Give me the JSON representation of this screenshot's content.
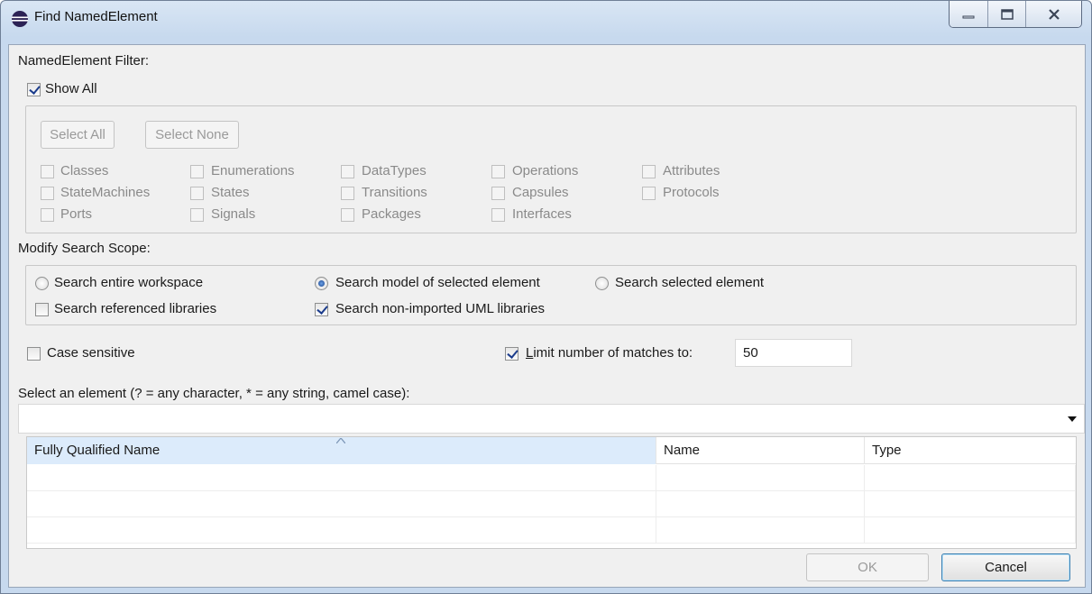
{
  "window": {
    "title": "Find NamedElement",
    "controls": [
      "minimize-icon",
      "maximize-icon",
      "close-icon"
    ]
  },
  "filter": {
    "label": "NamedElement Filter:",
    "show_all": {
      "label": "Show All",
      "checked": true
    },
    "select_all": "Select All",
    "select_none": "Select None",
    "types": [
      [
        "Classes",
        "Enumerations",
        "DataTypes",
        "Operations",
        "Attributes"
      ],
      [
        "StateMachines",
        "States",
        "Transitions",
        "Capsules",
        "Protocols"
      ],
      [
        "Ports",
        "Signals",
        "Packages",
        "Interfaces"
      ]
    ]
  },
  "scope": {
    "label": "Modify Search Scope:",
    "entire_workspace": "Search entire workspace",
    "model_of_selected": "Search model of selected element",
    "selected_element": "Search selected element",
    "selected_option": "Search model of selected element",
    "referenced_libraries": {
      "label": "Search referenced libraries",
      "checked": false
    },
    "non_imported_uml": {
      "label": "Search non-imported UML libraries",
      "checked": true
    }
  },
  "options": {
    "case_sensitive": {
      "label": "Case sensitive",
      "checked": false
    },
    "limit_prefix": "L",
    "limit_rest": "imit number of matches to:",
    "limit_checked": true,
    "limit_value": "50"
  },
  "search": {
    "label": "Select an element (? = any character, * = any string, camel case):",
    "value": ""
  },
  "table": {
    "columns": [
      "Fully Qualified Name",
      "Name",
      "Type"
    ],
    "sorted_column": "Fully Qualified Name",
    "rows": []
  },
  "buttons": {
    "ok": "OK",
    "cancel": "Cancel"
  }
}
